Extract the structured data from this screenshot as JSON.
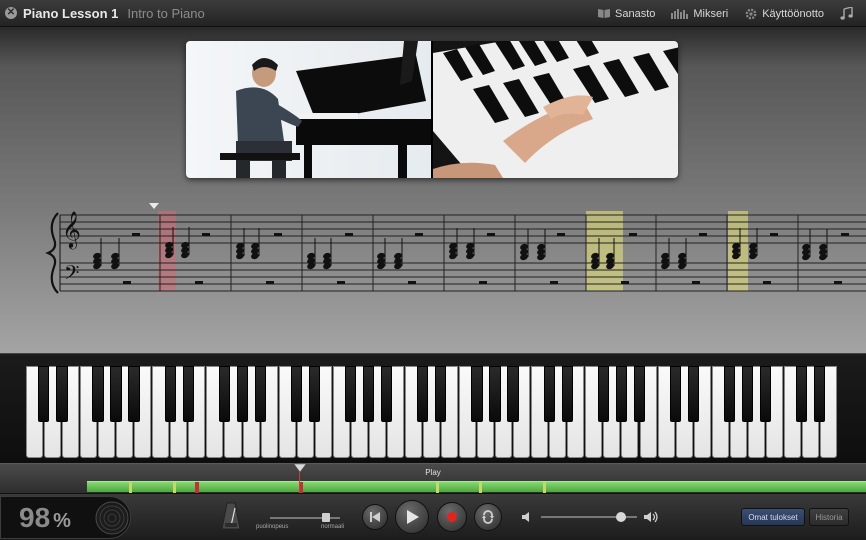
{
  "titlebar": {
    "close_glyph": "✕",
    "title": "Piano Lesson 1",
    "subtitle": "Intro to Piano",
    "nav": [
      {
        "label": "Sanasto",
        "icon": "book-icon"
      },
      {
        "label": "Mikseri",
        "icon": "mixer-icon"
      },
      {
        "label": "Käyttöönotto",
        "icon": "gear-icon"
      },
      {
        "label": "",
        "icon": "music-note-icon"
      }
    ]
  },
  "video": {
    "left_panel": "pianist-wide-shot",
    "right_panel": "hands-closeup-shot"
  },
  "timeline": {
    "label": "Play",
    "progress_marks": [
      "red",
      "red"
    ]
  },
  "transport": {
    "score_value": "98",
    "score_unit": "%",
    "tempo_left_label": "puolinopeus",
    "tempo_right_label": "normaali",
    "tempo_level": 0.8,
    "volume_level": 0.83,
    "my_results_label": "Omat tulokset",
    "history_label": "Historia"
  },
  "colors": {
    "timeline_green": "#4ea83e",
    "error_mark": "#c0313a",
    "highlight_red": "#d36a72",
    "highlight_yellow": "#e4e07a",
    "accent_blue": "#263656"
  }
}
